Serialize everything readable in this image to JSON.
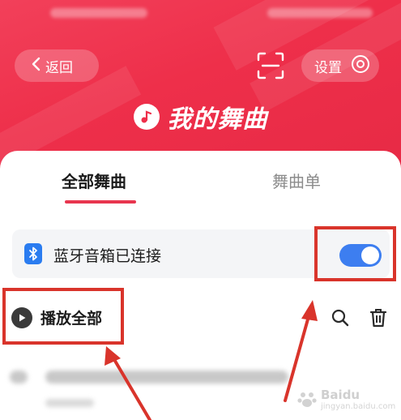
{
  "header": {
    "back_label": "返回",
    "settings_label": "设置",
    "title": "我的舞曲"
  },
  "tabs": [
    {
      "label": "全部舞曲",
      "active": true
    },
    {
      "label": "舞曲单",
      "active": false
    }
  ],
  "bluetooth": {
    "label": "蓝牙音箱已连接",
    "toggle_on": true
  },
  "actions": {
    "play_all_label": "播放全部"
  },
  "watermark": {
    "brand": "Baidu",
    "sub": "jingyan.baidu.com"
  },
  "colors": {
    "header_red": "#ee2f4a",
    "accent": "#e8364f",
    "toggle_blue": "#3d7ef0",
    "annotation_red": "#d9342b"
  }
}
